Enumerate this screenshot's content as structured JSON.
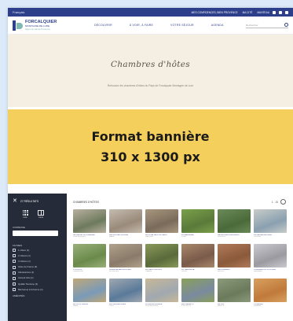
{
  "topbar": {
    "lang": "Français",
    "links": [
      "MES CONFIDENCES, BIEN PROVENCE",
      "MA CITÉ",
      "MANTEAU"
    ]
  },
  "header": {
    "logo_title": "FORCALQUIER",
    "logo_sub": "MONTAGNE DE LURE",
    "logo_sub2": "Alpes de Haute-Provence",
    "nav": [
      "DÉCOUVRIR",
      "À VOIR, À FAIRE",
      "VOTRE SÉJOUR",
      "AGENDA"
    ],
    "search_placeholder": "Rechercher"
  },
  "hero": {
    "title": "Chambres d'hôtes",
    "description": "Retrouvez les chambres d'hôtes du Pays de Forcalquier Montagne de Lure"
  },
  "banner": {
    "line1": "Format bannière",
    "line2": "310 x 1300 px"
  },
  "sidebar": {
    "count": "27 RÉSULTATS",
    "view_list": "Liste",
    "view_map": "Carte",
    "commune_label": "COMMUNE",
    "filters_label": "FILTRES",
    "filters": [
      "1 critère (1)",
      "2 critères (1)",
      "3 critères (1)",
      "Gîtes de France (6)",
      "Clévacances (1)",
      "Accueil Vélo (1)",
      "Qualité Tourisme (3)",
      "Bienvenue à la Ferme (1)"
    ],
    "more_label": "AMÉNITÉS"
  },
  "content": {
    "title": "CHAMBRES D'HÔTES",
    "pager": "1 - 15",
    "cards": [
      {
        "title": "LE JARDIN DU PRIEURÉ",
        "loc": "FORCALQUIER",
        "c1": "#6d7a5c",
        "c2": "#b8b0a0"
      },
      {
        "title": "MAISON DE VILLAGE",
        "loc": "MANE",
        "c1": "#9a8a7a",
        "c2": "#c4bcb0"
      },
      {
        "title": "BASTIDE DES OLIVIERS",
        "loc": "DAUPHIN",
        "c1": "#7a6a5a",
        "c2": "#a89880"
      },
      {
        "title": "LA BERGERIE",
        "loc": "LURS",
        "c1": "#5a7a3a",
        "c2": "#7aa04a"
      },
      {
        "title": "LE MAS DES LAVANDES",
        "loc": "SIGONCE",
        "c1": "#4a6a3a",
        "c2": "#6a8a5a"
      },
      {
        "title": "LA FERME DE LURE",
        "loc": "ONGLES",
        "c1": "#8aa0b0",
        "c2": "#c8ccc8"
      },
      {
        "title": "L'OUSTAU",
        "loc": "PIERRERUE",
        "c1": "#6a8a4a",
        "c2": "#9ab07a"
      },
      {
        "title": "DOMAINE DES ROCHES",
        "loc": "NIOZELLES",
        "c1": "#8a7a6a",
        "c2": "#b0a28c"
      },
      {
        "title": "LE VIEUX MOULIN",
        "loc": "LIMANS",
        "c1": "#5a6a3a",
        "c2": "#8a9a5a"
      },
      {
        "title": "LA TERRASSE",
        "loc": "CRUIS",
        "c1": "#7a5a4a",
        "c2": "#a8886a"
      },
      {
        "title": "LES CIGALES",
        "loc": "REVEST",
        "c1": "#8a5a3a",
        "c2": "#b07a5a"
      },
      {
        "title": "CHAMBRE DU CHÂTEAU",
        "loc": "SAUMANE",
        "c1": "#9a9aa0",
        "c2": "#cacad0"
      },
      {
        "title": "LE CLOS FLEURI",
        "loc": "MANE",
        "c1": "#7a9ab8",
        "c2": "#c0a878"
      },
      {
        "title": "LE PRÉ DES ÂNES",
        "loc": "LURS",
        "c1": "#5a7a9a",
        "c2": "#a0a8b0"
      },
      {
        "title": "LA MAISON BLEUE",
        "loc": "FORCALQUIER",
        "c1": "#a0a8b0",
        "c2": "#c8b898"
      },
      {
        "title": "LES GENÊTS",
        "loc": "STE-CROIX",
        "c1": "#7a8aa0",
        "c2": "#8aa05a"
      },
      {
        "title": "LE JAS",
        "loc": "BANON",
        "c1": "#6a7a5a",
        "c2": "#8a9a7a"
      },
      {
        "title": "L'ATELIER",
        "loc": "SIMIANE",
        "c1": "#c07a3a",
        "c2": "#d8a060"
      }
    ]
  },
  "colors": {
    "brand_blue": "#2d3f8a",
    "brand_teal": "#7fb7b2",
    "banner_yellow": "#f5cf5c",
    "hero_cream": "#f5efe3",
    "sidebar_dark": "#262b3a",
    "page_bg": "#dbe9f9"
  }
}
